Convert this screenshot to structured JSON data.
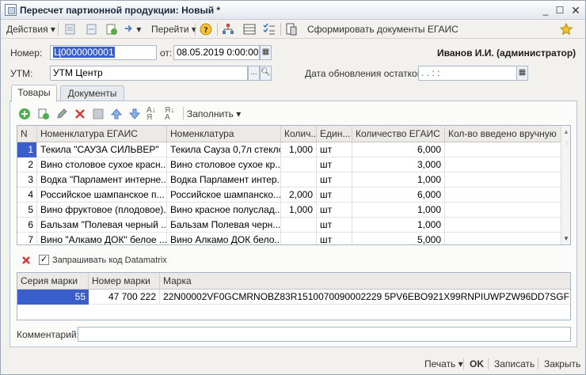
{
  "window": {
    "title": "Пересчет партионной продукции: Новый *"
  },
  "toolbar": {
    "actions_label": "Действия",
    "goto_label": "Перейти",
    "egais_label": "Сформировать документы ЕГАИС"
  },
  "header": {
    "number_label": "Номер:",
    "number_value": "Ц0000000001",
    "date_label": "от:",
    "date_value": "08.05.2019  0:00:00",
    "user": "Иванов И.И. (администратор)",
    "utm_label": "УТМ:",
    "utm_value": "УТМ Центр",
    "update_label": "Дата обновления остатков:",
    "update_value": ".  .      :  :"
  },
  "tabs": [
    {
      "label": "Товары"
    },
    {
      "label": "Документы"
    }
  ],
  "goods_toolbar": {
    "fill_label": "Заполнить"
  },
  "goods_table": {
    "columns": [
      "N",
      "Номенклатура ЕГАИС",
      "Номенклатура",
      "Колич...",
      "Един...",
      "Количество ЕГАИС",
      "Кол-во введено вручную"
    ],
    "rows": [
      {
        "n": "1",
        "egais": "Текила \"САУЗА СИЛЬВЕР\"",
        "nom": "Текила Сауза 0,7л стекло",
        "qty": "1,000",
        "unit": "шт",
        "qty_egais": "6,000",
        "manual": ""
      },
      {
        "n": "2",
        "egais": "Вино столовое сухое красн...",
        "nom": "Вино столовое сухое кр...",
        "qty": "",
        "unit": "шт",
        "qty_egais": "3,000",
        "manual": ""
      },
      {
        "n": "3",
        "egais": "Водка \"Парламент интерне...",
        "nom": "Водка Парламент интер...",
        "qty": "",
        "unit": "шт",
        "qty_egais": "1,000",
        "manual": ""
      },
      {
        "n": "4",
        "egais": "Российское шампанское п...",
        "nom": "Российское шампанско...",
        "qty": "2,000",
        "unit": "шт",
        "qty_egais": "6,000",
        "manual": ""
      },
      {
        "n": "5",
        "egais": "Вино фруктовое (плодовое)...",
        "nom": "Вино красное полуслад...",
        "qty": "1,000",
        "unit": "шт",
        "qty_egais": "1,000",
        "manual": ""
      },
      {
        "n": "6",
        "egais": "Бальзам \"Полевая черный ...",
        "nom": "Бальзам Полевая черн...",
        "qty": "",
        "unit": "шт",
        "qty_egais": "1,000",
        "manual": ""
      },
      {
        "n": "7",
        "egais": "Вино \"Алкамо ДОК\" белое ...",
        "nom": "Вино Алкамо ДОК бело...",
        "qty": "",
        "unit": "шт",
        "qty_egais": "5,000",
        "manual": ""
      }
    ]
  },
  "datamatrix": {
    "checkbox_label": "Запрашивать код Datamatrix",
    "checked": true
  },
  "marks_table": {
    "columns": [
      "Серия марки",
      "Номер марки",
      "Марка"
    ],
    "rows": [
      {
        "series": "55",
        "number": "47 700 222",
        "mark": "22N00002VF0GCMRNOBZ83R1510070090002229 5PV6EBO921X99RNPIUWPZW96DD7SGF"
      }
    ]
  },
  "comment": {
    "label": "Комментарий:",
    "value": ""
  },
  "footer": {
    "print_label": "Печать",
    "ok_label": "OK",
    "save_label": "Записать",
    "close_label": "Закрыть"
  },
  "colors": {
    "accent": "#3a5fcd",
    "selected_row": "#3a5fcd"
  }
}
